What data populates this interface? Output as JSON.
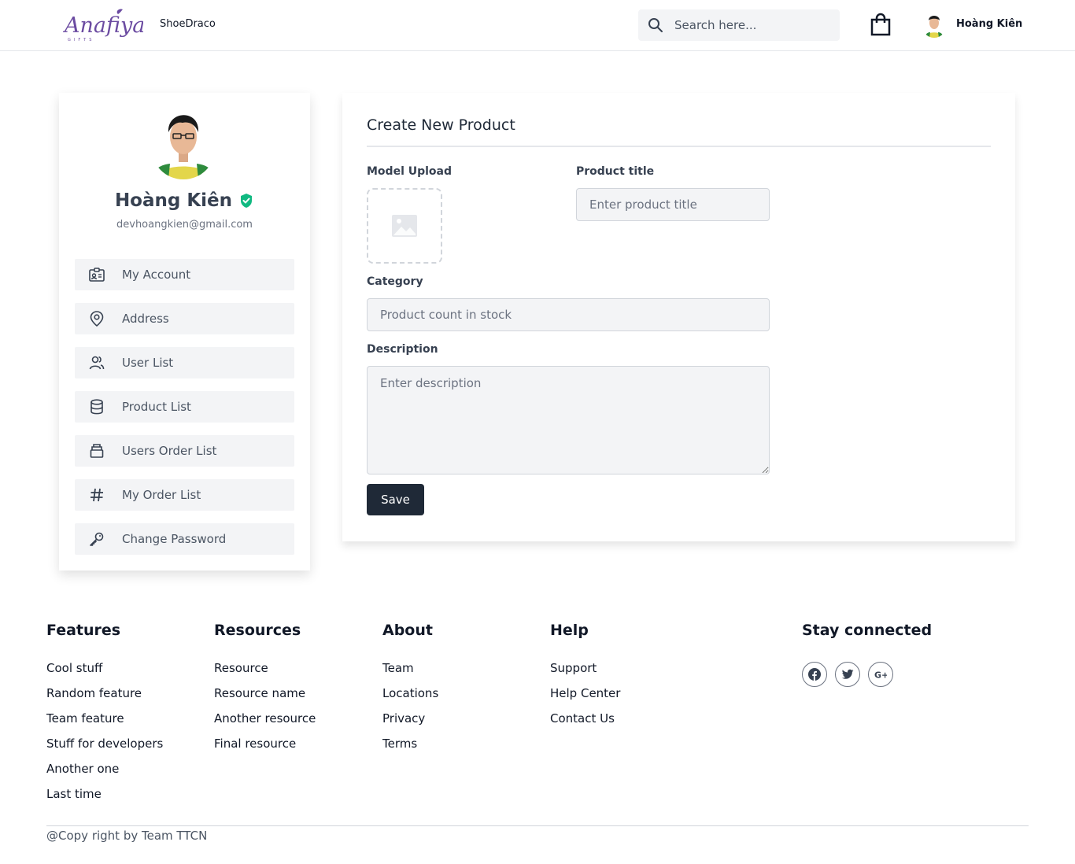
{
  "header": {
    "logo_text": "Anafiya",
    "logo_sub": "GIFTS",
    "brand": "ShoeDraco",
    "search_placeholder": "Search here...",
    "user_name": "Hoàng Kiên"
  },
  "profile": {
    "name": "Hoàng Kiên",
    "email": "devhoangkien@gmail.com",
    "menu": [
      {
        "label": "My Account",
        "icon": "id-card-icon"
      },
      {
        "label": "Address",
        "icon": "location-pin-icon"
      },
      {
        "label": "User List",
        "icon": "users-icon"
      },
      {
        "label": "Product List",
        "icon": "database-icon"
      },
      {
        "label": "Users Order List",
        "icon": "archive-icon"
      },
      {
        "label": "My Order List",
        "icon": "hash-icon"
      },
      {
        "label": "Change Password",
        "icon": "key-icon"
      }
    ]
  },
  "form": {
    "title": "Create New Product",
    "model_upload_label": "Model Upload",
    "product_title_label": "Product title",
    "product_title_placeholder": "Enter product title",
    "category_label": "Category",
    "category_placeholder": "Product count in stock",
    "description_label": "Description",
    "description_placeholder": "Enter description",
    "save_label": "Save"
  },
  "footer": {
    "columns": [
      {
        "heading": "Features",
        "links": [
          "Cool stuff",
          "Random feature",
          "Team feature",
          "Stuff for developers",
          "Another one",
          "Last time"
        ]
      },
      {
        "heading": "Resources",
        "links": [
          "Resource",
          "Resource name",
          "Another resource",
          "Final resource"
        ]
      },
      {
        "heading": "About",
        "links": [
          "Team",
          "Locations",
          "Privacy",
          "Terms"
        ]
      },
      {
        "heading": "Help",
        "links": [
          "Support",
          "Help Center",
          "Contact Us"
        ]
      }
    ],
    "stay_connected": "Stay connected",
    "social_icons": [
      "facebook-icon",
      "twitter-icon",
      "google-plus-icon"
    ],
    "copyright": "@Copy right by Team TTCN"
  },
  "colors": {
    "primary_button": "#1f2937",
    "input_bg": "#f3f4f6",
    "verified": "#10b981",
    "logo": "#6b4ba1"
  }
}
